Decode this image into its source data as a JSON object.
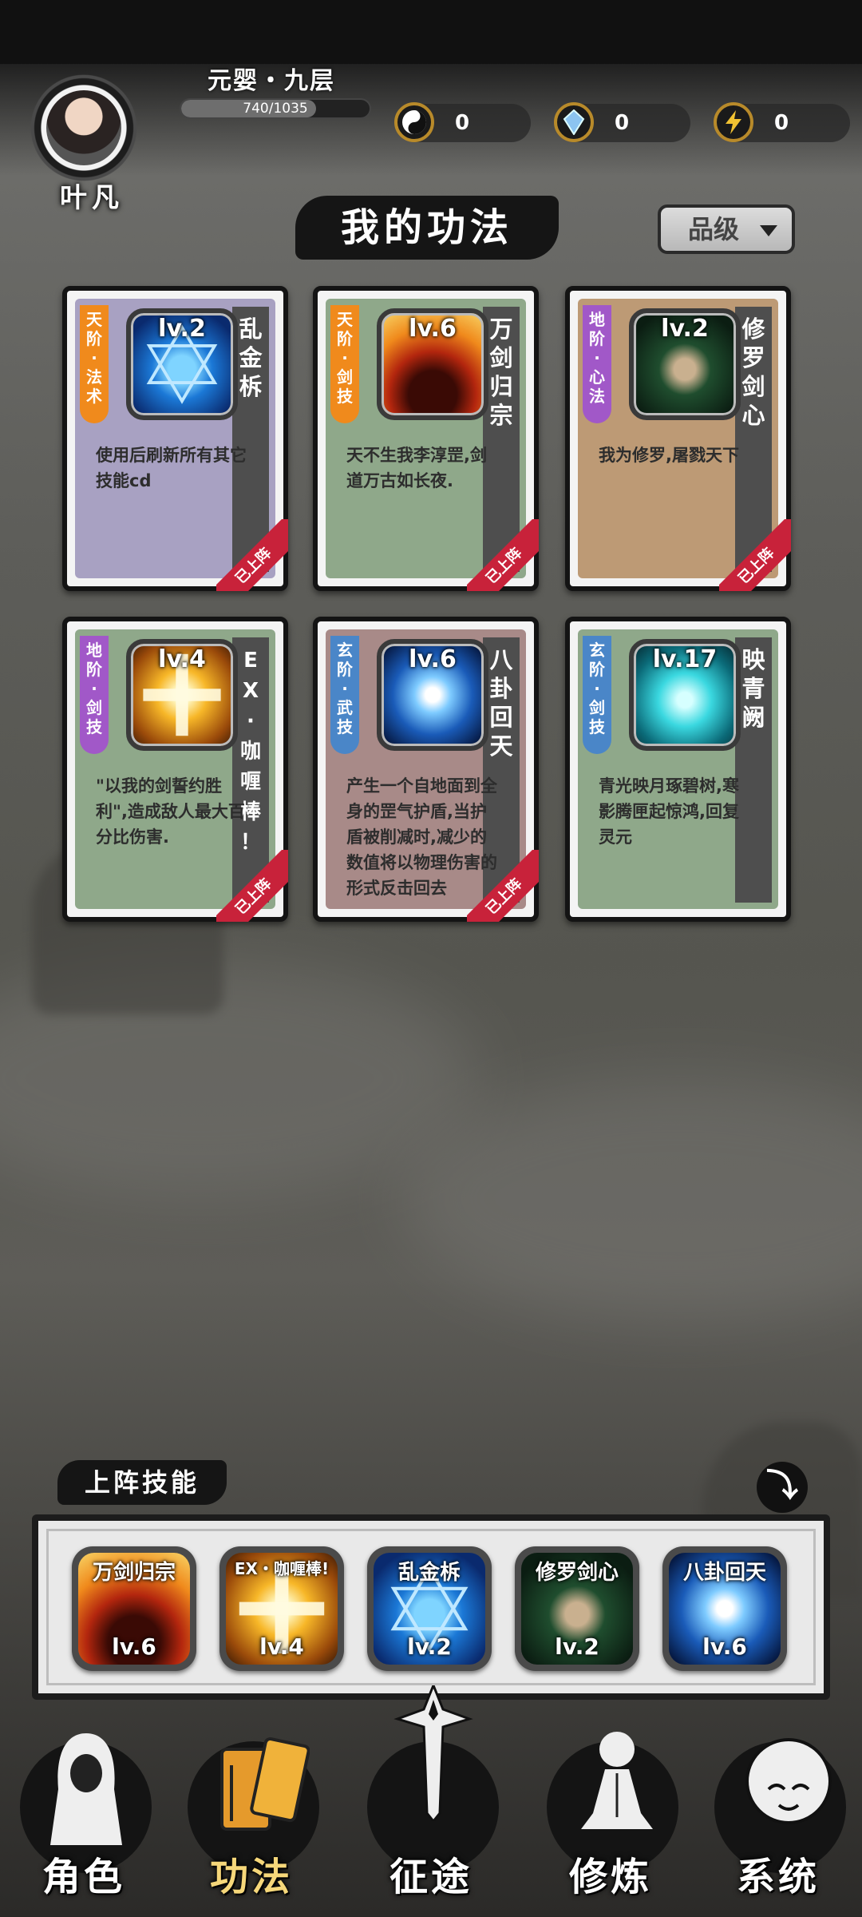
{
  "header": {
    "player_name": "叶凡",
    "realm": "元婴・九层",
    "exp": {
      "current": 740,
      "max": 1035,
      "label": "740/1035"
    },
    "currencies": [
      {
        "icon": "yin-yang-icon",
        "value": "0",
        "color": "#d8b24a"
      },
      {
        "icon": "spirit-crystal-icon",
        "value": "0",
        "color": "#7fb7e8"
      },
      {
        "icon": "lightning-icon",
        "value": "0",
        "color": "#f1c232"
      }
    ]
  },
  "page": {
    "title": "我的功法",
    "sort_label": "品级"
  },
  "skills": [
    {
      "tier": [
        "天",
        "阶",
        "·",
        "法",
        "术"
      ],
      "tier_color": "#f08a1c",
      "name": [
        "乱",
        "金",
        "柝"
      ],
      "level": "lv.2",
      "desc": "使用后刷新所有其它技能cd",
      "bg": "#a8a1c2",
      "icon": "hexagram-icon",
      "equipped": "已上阵"
    },
    {
      "tier": [
        "天",
        "阶",
        "·",
        "剑",
        "技"
      ],
      "tier_color": "#f08a1c",
      "name": [
        "万",
        "剑",
        "归",
        "宗"
      ],
      "level": "lv.6",
      "desc": "天不生我李淳罡,剑道万古如长夜.",
      "bg": "#8fa88a",
      "icon": "volcano-sword-icon",
      "equipped": "已上阵"
    },
    {
      "tier": [
        "地",
        "阶",
        "·",
        "心",
        "法"
      ],
      "tier_color": "#a158c8",
      "name": [
        "修",
        "罗",
        "剑",
        "心"
      ],
      "level": "lv.2",
      "desc": "我为修罗,屠戮天下",
      "bg": "#bd9a75",
      "icon": "hooded-warrior-icon",
      "equipped": "已上阵"
    },
    {
      "tier": [
        "地",
        "阶",
        "·",
        "剑",
        "技"
      ],
      "tier_color": "#a158c8",
      "name": [
        "E",
        "X",
        "·",
        "咖",
        "喱",
        "棒",
        "！"
      ],
      "level": "lv.4",
      "desc": "\"以我的剑誓约胜利\",造成敌人最大百分比伤害.",
      "bg": "#8fa88a",
      "icon": "golden-cross-icon",
      "equipped": "已上阵"
    },
    {
      "tier": [
        "玄",
        "阶",
        "·",
        "武",
        "技"
      ],
      "tier_color": "#4a86c8",
      "name": [
        "八",
        "卦",
        "回",
        "天"
      ],
      "level": "lv.6",
      "desc": "产生一个自地面到全身的罡气护盾,当护盾被削减时,减少的数值将以物理伤害的形式反击回去",
      "bg": "#a88a88",
      "icon": "energy-orb-icon",
      "equipped": "已上阵"
    },
    {
      "tier": [
        "玄",
        "阶",
        "·",
        "剑",
        "技"
      ],
      "tier_color": "#4a86c8",
      "name": [
        "映",
        "青",
        "阙"
      ],
      "level": "lv.17",
      "desc": "青光映月琢碧树,寒影腾匣起惊鸿,回复灵元",
      "bg": "#8fa88a",
      "icon": "cyan-vortex-icon",
      "equipped": ""
    }
  ],
  "deploy": {
    "title": "上阵技能",
    "collapse_icon": "arrow-down-icon",
    "slots": [
      {
        "name": "万剑归宗",
        "level": "lv.6",
        "icon": "volcano-sword-icon"
      },
      {
        "name": "EX・咖喱棒!",
        "level": "lv.4",
        "icon": "golden-cross-icon"
      },
      {
        "name": "乱金柝",
        "level": "lv.2",
        "icon": "hexagram-icon"
      },
      {
        "name": "修罗剑心",
        "level": "lv.2",
        "icon": "hooded-warrior-icon"
      },
      {
        "name": "八卦回天",
        "level": "lv.6",
        "icon": "energy-orb-icon"
      }
    ]
  },
  "nav": [
    {
      "label": "角色",
      "icon": "character-icon",
      "active": false
    },
    {
      "label": "功法",
      "icon": "skill-book-icon",
      "active": true
    },
    {
      "label": "征途",
      "icon": "journey-sword-icon",
      "active": false
    },
    {
      "label": "修炼",
      "icon": "meditation-icon",
      "active": false
    },
    {
      "label": "系统",
      "icon": "system-mascot-icon",
      "active": false
    }
  ]
}
